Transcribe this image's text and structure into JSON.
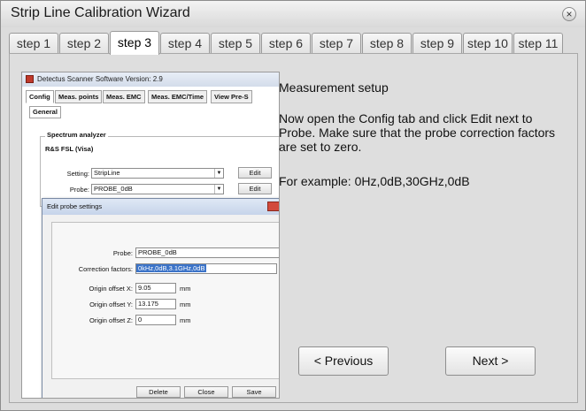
{
  "window": {
    "title": "Strip Line Calibration Wizard",
    "close_glyph": "×"
  },
  "tabs": [
    "step 1",
    "step 2",
    "step 3",
    "step 4",
    "step 5",
    "step 6",
    "step 7",
    "step 8",
    "step 9",
    "step 10",
    "step 11"
  ],
  "active_tab": "step 3",
  "instructions": {
    "heading": "Measurement setup",
    "body": "Now open the Config tab and click Edit next to Probe. Make sure that the probe correction factors are set to zero.",
    "example": "For example: 0Hz,0dB,30GHz,0dB"
  },
  "buttons": {
    "previous": "< Previous",
    "next": "Next >"
  },
  "screenshot": {
    "app_title": "Detectus Scanner Software Version: 2.9",
    "tabs": [
      "Config",
      "Meas. points",
      "Meas. EMC",
      "Meas. EMC/Time",
      "View Pre-S"
    ],
    "subtab": "General",
    "group_label": "Spectrum analyzer",
    "analyzer_value": "R&S FSL (Visa)",
    "setting_label": "Setting:",
    "setting_value": "StripLine",
    "probe_label": "Probe:",
    "probe_value": "PROBE_0dB",
    "edit_label": "Edit",
    "dialog": {
      "title": "Edit probe settings",
      "probe_label": "Probe:",
      "probe_value": "PROBE_0dB",
      "correction_label": "Correction factors:",
      "correction_value": "0kHz,0dB,3.1GHz,0dB",
      "offset_x_label": "Origin offset X:",
      "offset_x_value": "9.05",
      "offset_y_label": "Origin offset Y:",
      "offset_y_value": "13.175",
      "offset_z_label": "Origin offset Z:",
      "offset_z_value": "0",
      "unit": "mm",
      "delete": "Delete",
      "close": "Close",
      "save": "Save"
    }
  },
  "colors": {
    "panel_bg": "#dedede",
    "selection": "#3b73c8"
  }
}
